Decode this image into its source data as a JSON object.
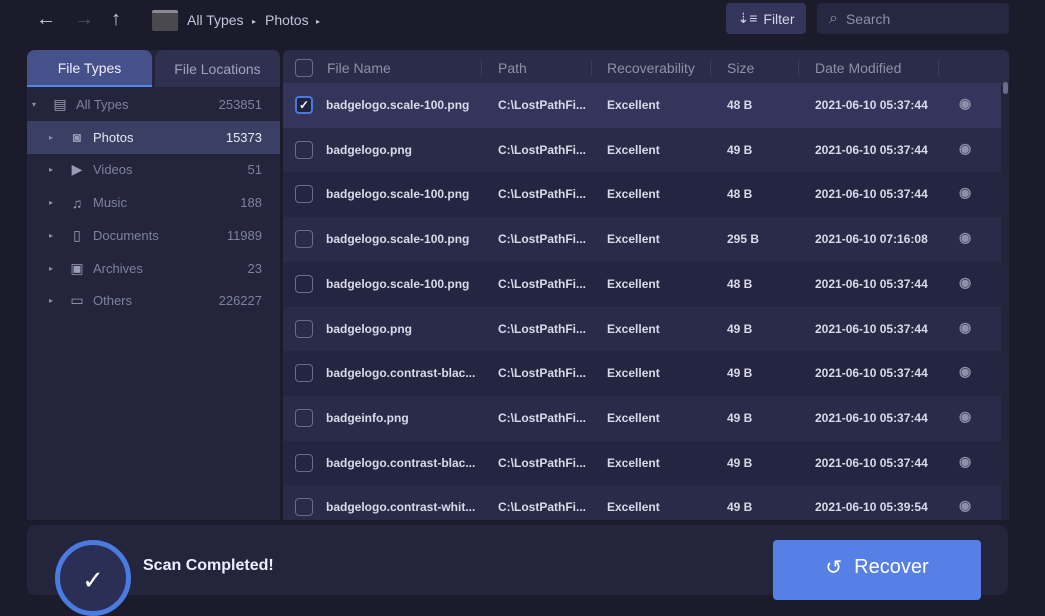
{
  "breadcrumb": [
    "All Types",
    "Photos"
  ],
  "toolbar": {
    "filter_label": "Filter",
    "search_placeholder": "Search"
  },
  "tabs": [
    "File Types",
    "File Locations"
  ],
  "tree": [
    {
      "label": "All Types",
      "count": "253851",
      "icon": "document-icon"
    },
    {
      "label": "Photos",
      "count": "15373",
      "icon": "camera-icon"
    },
    {
      "label": "Videos",
      "count": "51",
      "icon": "video-icon"
    },
    {
      "label": "Music",
      "count": "188",
      "icon": "music-icon"
    },
    {
      "label": "Documents",
      "count": "11989",
      "icon": "file-icon"
    },
    {
      "label": "Archives",
      "count": "23",
      "icon": "archive-icon"
    },
    {
      "label": "Others",
      "count": "226227",
      "icon": "folder-icon"
    }
  ],
  "columns": [
    "File Name",
    "Path",
    "Recoverability",
    "Size",
    "Date Modified"
  ],
  "rows": [
    {
      "name": "badgelogo.scale-100.png",
      "path": "C:\\LostPathFi...",
      "rec": "Excellent",
      "size": "48 B",
      "date": "2021-06-10 05:37:44",
      "checked": true
    },
    {
      "name": "badgelogo.png",
      "path": "C:\\LostPathFi...",
      "rec": "Excellent",
      "size": "49 B",
      "date": "2021-06-10 05:37:44"
    },
    {
      "name": "badgelogo.scale-100.png",
      "path": "C:\\LostPathFi...",
      "rec": "Excellent",
      "size": "48 B",
      "date": "2021-06-10 05:37:44"
    },
    {
      "name": "badgelogo.scale-100.png",
      "path": "C:\\LostPathFi...",
      "rec": "Excellent",
      "size": "295 B",
      "date": "2021-06-10 07:16:08"
    },
    {
      "name": "badgelogo.scale-100.png",
      "path": "C:\\LostPathFi...",
      "rec": "Excellent",
      "size": "48 B",
      "date": "2021-06-10 05:37:44"
    },
    {
      "name": "badgelogo.png",
      "path": "C:\\LostPathFi...",
      "rec": "Excellent",
      "size": "49 B",
      "date": "2021-06-10 05:37:44"
    },
    {
      "name": "badgelogo.contrast-blac...",
      "path": "C:\\LostPathFi...",
      "rec": "Excellent",
      "size": "49 B",
      "date": "2021-06-10 05:37:44"
    },
    {
      "name": "badgeinfo.png",
      "path": "C:\\LostPathFi...",
      "rec": "Excellent",
      "size": "49 B",
      "date": "2021-06-10 05:37:44"
    },
    {
      "name": "badgelogo.contrast-blac...",
      "path": "C:\\LostPathFi...",
      "rec": "Excellent",
      "size": "49 B",
      "date": "2021-06-10 05:37:44"
    },
    {
      "name": "badgelogo.contrast-whit...",
      "path": "C:\\LostPathFi...",
      "rec": "Excellent",
      "size": "49 B",
      "date": "2021-06-10 05:39:54"
    }
  ],
  "status": {
    "title": "Scan Completed!"
  },
  "recover_label": "Recover"
}
